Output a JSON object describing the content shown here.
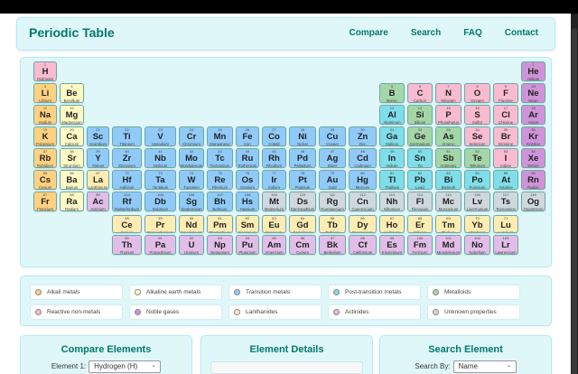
{
  "header": {
    "title": "Periodic Table",
    "nav": [
      "Compare",
      "Search",
      "FAQ",
      "Contact"
    ]
  },
  "colors": {
    "alkali": "#ffd180",
    "alkaline": "#fff9c4",
    "transition": "#90caf9",
    "post": "#80deea",
    "metalloid": "#a5d6a7",
    "nonmetal": "#f8bbd0",
    "noble": "#ce93d8",
    "lanthanide": "#ffecb3",
    "actinide": "#e1bee7",
    "unknown": "#cfd8dc"
  },
  "legend": [
    {
      "key": "alkali",
      "label": "Alkali metals"
    },
    {
      "key": "alkaline",
      "label": "Alkaline earth metals"
    },
    {
      "key": "transition",
      "label": "Transition metals"
    },
    {
      "key": "post",
      "label": "Post-transition metals"
    },
    {
      "key": "metalloid",
      "label": "Metalloids"
    },
    {
      "key": "nonmetal",
      "label": "Reactive non-metals"
    },
    {
      "key": "noble",
      "label": "Noble gases"
    },
    {
      "key": "lanthanide",
      "label": "Lanthanides"
    },
    {
      "key": "actinide",
      "label": "Actinides"
    },
    {
      "key": "unknown",
      "label": "Unknown properties"
    }
  ],
  "elements": [
    [
      "H",
      "Hydrogen",
      "nonmetal"
    ],
    [
      "He",
      "Helium",
      "noble"
    ],
    [
      "Li",
      "Lithium",
      "alkali"
    ],
    [
      "Be",
      "Beryllium",
      "alkaline"
    ],
    [
      "B",
      "Boron",
      "metalloid"
    ],
    [
      "C",
      "Carbon",
      "nonmetal"
    ],
    [
      "N",
      "Nitrogen",
      "nonmetal"
    ],
    [
      "O",
      "Oxygen",
      "nonmetal"
    ],
    [
      "F",
      "Fluorine",
      "nonmetal"
    ],
    [
      "Ne",
      "Neon",
      "noble"
    ],
    [
      "Na",
      "Sodium",
      "alkali"
    ],
    [
      "Mg",
      "Magnesium",
      "alkaline"
    ],
    [
      "Al",
      "Aluminum",
      "post"
    ],
    [
      "Si",
      "Silicon",
      "metalloid"
    ],
    [
      "P",
      "Phosphorus",
      "nonmetal"
    ],
    [
      "S",
      "Sulfur",
      "nonmetal"
    ],
    [
      "Cl",
      "Chlorine",
      "nonmetal"
    ],
    [
      "Ar",
      "Argon",
      "noble"
    ],
    [
      "K",
      "Potassium",
      "alkali"
    ],
    [
      "Ca",
      "Calcium",
      "alkaline"
    ],
    [
      "Sc",
      "Scandium",
      "transition"
    ],
    [
      "Ti",
      "Titanium",
      "transition"
    ],
    [
      "V",
      "Vanadium",
      "transition"
    ],
    [
      "Cr",
      "Chromium",
      "transition"
    ],
    [
      "Mn",
      "Manganese",
      "transition"
    ],
    [
      "Fe",
      "Iron",
      "transition"
    ],
    [
      "Co",
      "Cobalt",
      "transition"
    ],
    [
      "Ni",
      "Nickel",
      "transition"
    ],
    [
      "Cu",
      "Copper",
      "transition"
    ],
    [
      "Zn",
      "Zinc",
      "transition"
    ],
    [
      "Ga",
      "Gallium",
      "post"
    ],
    [
      "Ge",
      "Germanium",
      "metalloid"
    ],
    [
      "As",
      "Arsenic",
      "metalloid"
    ],
    [
      "Se",
      "Selenium",
      "nonmetal"
    ],
    [
      "Br",
      "Bromine",
      "nonmetal"
    ],
    [
      "Kr",
      "Krypton",
      "noble"
    ],
    [
      "Rb",
      "Rubidium",
      "alkali"
    ],
    [
      "Sr",
      "Strontium",
      "alkaline"
    ],
    [
      "Y",
      "Yttrium",
      "transition"
    ],
    [
      "Zr",
      "Zirconium",
      "transition"
    ],
    [
      "Nb",
      "Niobium",
      "transition"
    ],
    [
      "Mo",
      "Molybdenum",
      "transition"
    ],
    [
      "Tc",
      "Technetium",
      "transition"
    ],
    [
      "Ru",
      "Ruthenium",
      "transition"
    ],
    [
      "Rh",
      "Rhodium",
      "transition"
    ],
    [
      "Pd",
      "Palladium",
      "transition"
    ],
    [
      "Ag",
      "Silver",
      "transition"
    ],
    [
      "Cd",
      "Cadmium",
      "transition"
    ],
    [
      "In",
      "Indium",
      "post"
    ],
    [
      "Sn",
      "Tin",
      "post"
    ],
    [
      "Sb",
      "Antimony",
      "metalloid"
    ],
    [
      "Te",
      "Tellurium",
      "metalloid"
    ],
    [
      "I",
      "Iodine",
      "nonmetal"
    ],
    [
      "Xe",
      "Xenon",
      "noble"
    ],
    [
      "Cs",
      "Cesium",
      "alkali"
    ],
    [
      "Ba",
      "Barium",
      "alkaline"
    ],
    [
      "La",
      "Lanthanum",
      "lanthanide"
    ],
    [
      "Ce",
      "Cerium",
      "lanthanide"
    ],
    [
      "Pr",
      "Praseodymium",
      "lanthanide"
    ],
    [
      "Nd",
      "Neodymium",
      "lanthanide"
    ],
    [
      "Pm",
      "Promethium",
      "lanthanide"
    ],
    [
      "Sm",
      "Samarium",
      "lanthanide"
    ],
    [
      "Eu",
      "Europium",
      "lanthanide"
    ],
    [
      "Gd",
      "Gadolinium",
      "lanthanide"
    ],
    [
      "Tb",
      "Terbium",
      "lanthanide"
    ],
    [
      "Dy",
      "Dysprosium",
      "lanthanide"
    ],
    [
      "Ho",
      "Holmium",
      "lanthanide"
    ],
    [
      "Er",
      "Erbium",
      "lanthanide"
    ],
    [
      "Tm",
      "Thulium",
      "lanthanide"
    ],
    [
      "Yb",
      "Ytterbium",
      "lanthanide"
    ],
    [
      "Lu",
      "Lutetium",
      "lanthanide"
    ],
    [
      "Hf",
      "Hafnium",
      "transition"
    ],
    [
      "Ta",
      "Tantalum",
      "transition"
    ],
    [
      "W",
      "Tungsten",
      "transition"
    ],
    [
      "Re",
      "Rhenium",
      "transition"
    ],
    [
      "Os",
      "Osmium",
      "transition"
    ],
    [
      "Ir",
      "Iridium",
      "transition"
    ],
    [
      "Pt",
      "Platinum",
      "transition"
    ],
    [
      "Au",
      "Gold",
      "transition"
    ],
    [
      "Hg",
      "Mercury",
      "transition"
    ],
    [
      "Tl",
      "Thallium",
      "post"
    ],
    [
      "Pb",
      "Lead",
      "post"
    ],
    [
      "Bi",
      "Bismuth",
      "post"
    ],
    [
      "Po",
      "Polonium",
      "post"
    ],
    [
      "At",
      "Astatine",
      "post"
    ],
    [
      "Rn",
      "Radon",
      "noble"
    ],
    [
      "Fr",
      "Francium",
      "alkali"
    ],
    [
      "Ra",
      "Radium",
      "alkaline"
    ],
    [
      "Ac",
      "Actinium",
      "actinide"
    ],
    [
      "Th",
      "Thorium",
      "actinide"
    ],
    [
      "Pa",
      "Protactinium",
      "actinide"
    ],
    [
      "U",
      "Uranium",
      "actinide"
    ],
    [
      "Np",
      "Neptunium",
      "actinide"
    ],
    [
      "Pu",
      "Plutonium",
      "actinide"
    ],
    [
      "Am",
      "Americium",
      "actinide"
    ],
    [
      "Cm",
      "Curium",
      "actinide"
    ],
    [
      "Bk",
      "Berkelium",
      "actinide"
    ],
    [
      "Cf",
      "Californium",
      "actinide"
    ],
    [
      "Es",
      "Einsteinium",
      "actinide"
    ],
    [
      "Fm",
      "Fermium",
      "actinide"
    ],
    [
      "Md",
      "Mendelevium",
      "actinide"
    ],
    [
      "No",
      "Nobelium",
      "actinide"
    ],
    [
      "Lr",
      "Lawrencium",
      "actinide"
    ],
    [
      "Rf",
      "Rutherfordium",
      "transition"
    ],
    [
      "Db",
      "Dubnium",
      "transition"
    ],
    [
      "Sg",
      "Seaborgium",
      "transition"
    ],
    [
      "Bh",
      "Bohrium",
      "transition"
    ],
    [
      "Hs",
      "Hassium",
      "transition"
    ],
    [
      "Mt",
      "Meitnerium",
      "unknown"
    ],
    [
      "Ds",
      "Darmstadtium",
      "unknown"
    ],
    [
      "Rg",
      "Roentgenium",
      "unknown"
    ],
    [
      "Cn",
      "Copernicium",
      "unknown"
    ],
    [
      "Nh",
      "Nihonium",
      "unknown"
    ],
    [
      "Fl",
      "Flerovium",
      "unknown"
    ],
    [
      "Mc",
      "Moscovium",
      "unknown"
    ],
    [
      "Lv",
      "Livermorium",
      "unknown"
    ],
    [
      "Ts",
      "Tennessine",
      "unknown"
    ],
    [
      "Og",
      "Oganesson",
      "unknown"
    ]
  ],
  "compare": {
    "title": "Compare Elements",
    "label1": "Element 1:",
    "value1": "Hydrogen (H)"
  },
  "details": {
    "title": "Element Details"
  },
  "search": {
    "title": "Search Element",
    "label": "Search By:",
    "value": "Name"
  }
}
